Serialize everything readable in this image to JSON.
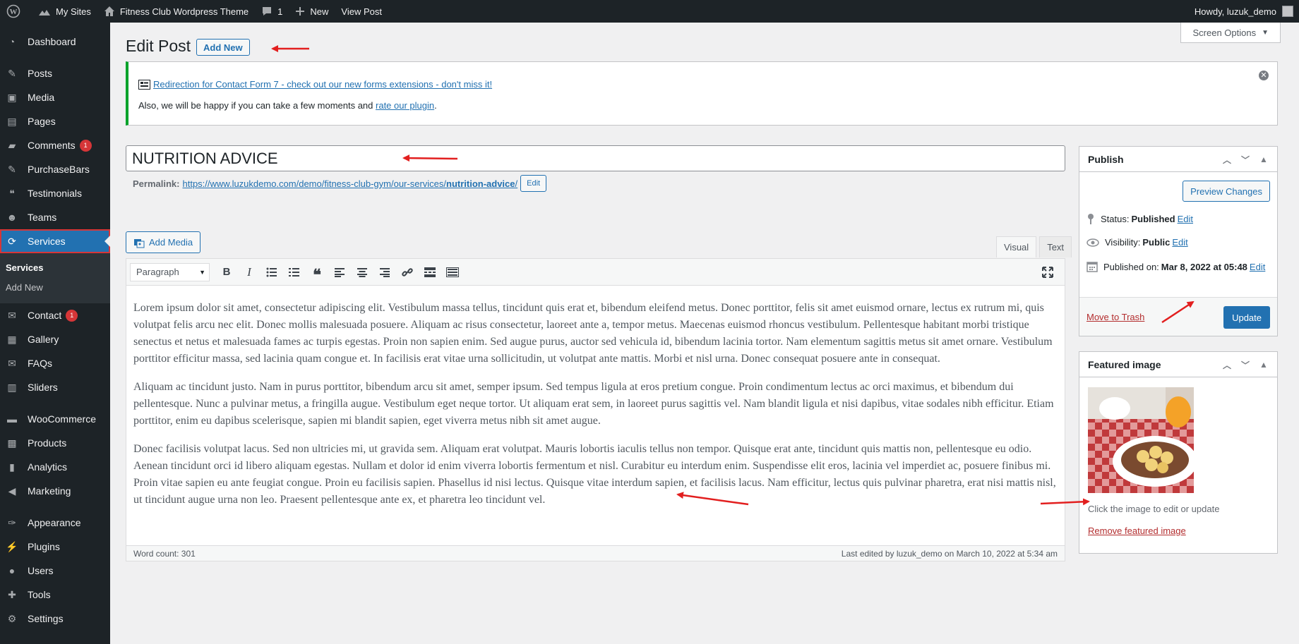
{
  "adminbar": {
    "my_sites": "My Sites",
    "site_name": "Fitness Club Wordpress Theme",
    "comments_count": "1",
    "new_label": "New",
    "view_post": "View Post",
    "howdy": "Howdy, luzuk_demo"
  },
  "sidebar": {
    "items": [
      {
        "label": "Dashboard",
        "icon": "dashboard-icon"
      },
      {
        "label": "Posts",
        "icon": "pushpin-icon"
      },
      {
        "label": "Media",
        "icon": "media-icon"
      },
      {
        "label": "Pages",
        "icon": "pages-icon"
      },
      {
        "label": "Comments",
        "icon": "comment-icon",
        "badge": "1"
      },
      {
        "label": "PurchaseBars",
        "icon": "pushpin-icon"
      },
      {
        "label": "Testimonials",
        "icon": "testimonial-icon"
      },
      {
        "label": "Teams",
        "icon": "groups-icon"
      },
      {
        "label": "Services",
        "icon": "update-icon"
      },
      {
        "label": "Contact",
        "icon": "email-icon",
        "badge": "1"
      },
      {
        "label": "Gallery",
        "icon": "gallery-icon"
      },
      {
        "label": "FAQs",
        "icon": "faq-icon"
      },
      {
        "label": "Sliders",
        "icon": "slides-icon"
      },
      {
        "label": "WooCommerce",
        "icon": "woo-icon"
      },
      {
        "label": "Products",
        "icon": "archive-icon"
      },
      {
        "label": "Analytics",
        "icon": "chart-icon"
      },
      {
        "label": "Marketing",
        "icon": "megaphone-icon"
      },
      {
        "label": "Appearance",
        "icon": "paintbrush-icon"
      },
      {
        "label": "Plugins",
        "icon": "plugin-icon"
      },
      {
        "label": "Users",
        "icon": "users-icon"
      },
      {
        "label": "Tools",
        "icon": "wrench-icon"
      },
      {
        "label": "Settings",
        "icon": "settings-icon"
      }
    ],
    "submenu": {
      "current": "Services",
      "add_new": "Add New"
    }
  },
  "header": {
    "screen_options": "Screen Options",
    "title": "Edit Post",
    "add_new": "Add New"
  },
  "notice": {
    "link_text": "Redirection for Contact Form 7 - check out our new forms extensions - don't miss it!",
    "line2_prefix": "Also, we will be happy if you can take a few moments and ",
    "line2_link": "rate our plugin",
    "line2_suffix": "."
  },
  "post": {
    "title": "NUTRITION ADVICE",
    "permalink_label": "Permalink:",
    "permalink_base": "https://www.luzukdemo.com/demo/fitness-club-gym/our-services/",
    "permalink_slug": "nutrition-advice",
    "permalink_trailing": "/",
    "permalink_edit": "Edit"
  },
  "editor": {
    "add_media": "Add Media",
    "tab_visual": "Visual",
    "tab_text": "Text",
    "format": "Paragraph",
    "paragraphs": [
      "Lorem ipsum dolor sit amet, consectetur adipiscing elit. Vestibulum massa tellus, tincidunt quis erat et, bibendum eleifend metus. Donec porttitor, felis sit amet euismod ornare, lectus ex rutrum mi, quis volutpat felis arcu nec elit. Donec mollis malesuada posuere. Aliquam ac risus consectetur, laoreet ante a, tempor metus. Maecenas euismod rhoncus vestibulum. Pellentesque habitant morbi tristique senectus et netus et malesuada fames ac turpis egestas. Proin non sapien enim. Sed augue purus, auctor sed vehicula id, bibendum lacinia tortor. Nam elementum sagittis metus sit amet ornare. Vestibulum porttitor efficitur massa, sed lacinia quam congue et. In facilisis erat vitae urna sollicitudin, ut volutpat ante mattis. Morbi et nisl urna. Donec consequat posuere ante in consequat.",
      "Aliquam ac tincidunt justo. Nam in purus porttitor, bibendum arcu sit amet, semper ipsum. Sed tempus ligula at eros pretium congue. Proin condimentum lectus ac orci maximus, et bibendum dui pellentesque. Nunc a pulvinar metus, a fringilla augue. Vestibulum eget neque tortor. Ut aliquam erat sem, in laoreet purus sagittis vel. Nam blandit ligula et nisi dapibus, vitae sodales nibh efficitur. Etiam porttitor, enim eu dapibus scelerisque, sapien mi blandit sapien, eget viverra metus nibh sit amet augue.",
      "Donec facilisis volutpat lacus. Sed non ultricies mi, ut gravida sem. Aliquam erat volutpat. Mauris lobortis iaculis tellus non tempor. Quisque erat ante, tincidunt quis mattis non, pellentesque eu odio. Aenean tincidunt orci id libero aliquam egestas. Nullam et dolor id enim viverra lobortis fermentum et nisl. Curabitur eu interdum enim. Suspendisse elit eros, lacinia vel imperdiet ac, posuere finibus mi. Proin vitae sapien eu ante feugiat congue. Proin eu facilisis sapien. Phasellus id nisi lectus. Quisque vitae interdum sapien, et facilisis lacus. Nam efficitur, lectus quis pulvinar pharetra, erat nisi mattis nisl, ut tincidunt augue urna non leo. Praesent pellentesque ante ex, et pharetra leo tincidunt vel."
    ],
    "word_count": "Word count: 301",
    "last_edited": "Last edited by luzuk_demo on March 10, 2022 at 5:34 am"
  },
  "publish": {
    "title": "Publish",
    "preview": "Preview Changes",
    "status_label": "Status:",
    "status_value": "Published",
    "visibility_label": "Visibility:",
    "visibility_value": "Public",
    "published_label": "Published on:",
    "published_value": "Mar 8, 2022 at 05:48",
    "edit": "Edit",
    "trash": "Move to Trash",
    "update": "Update"
  },
  "featured": {
    "title": "Featured image",
    "hint": "Click the image to edit or update",
    "remove": "Remove featured image"
  },
  "colors": {
    "admin_dark": "#1d2327",
    "accent": "#2271b1",
    "annotation_red": "#e21f1f",
    "notice_green": "#00a32a"
  }
}
